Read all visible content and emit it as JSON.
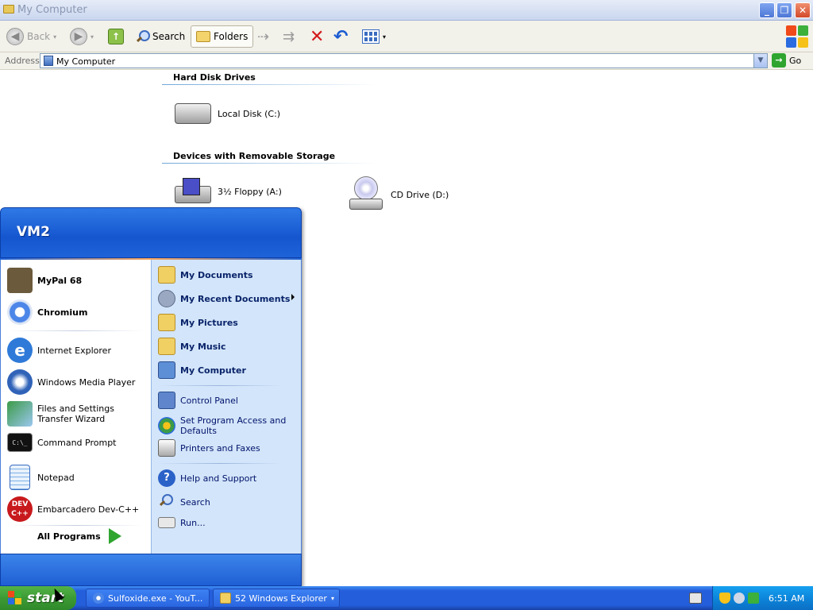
{
  "window": {
    "title": "My Computer",
    "min_glyph": "_",
    "max_glyph": "❐",
    "close_glyph": "✕"
  },
  "toolbar": {
    "back_label": "Back",
    "search_label": "Search",
    "folders_label": "Folders"
  },
  "address": {
    "label": "Address",
    "value": "My Computer",
    "go_label": "Go"
  },
  "groups": {
    "hard_disks_title": "Hard Disk Drives",
    "removable_title": "Devices with Removable Storage"
  },
  "drives": {
    "local_disk": "Local Disk (C:)",
    "floppy": "3½ Floppy (A:)",
    "cd": "CD Drive (D:)"
  },
  "start_menu": {
    "user": "VM2",
    "pinned": [
      {
        "label": "MyPal 68",
        "icon": "mypal-icon",
        "color": "#6b5a3c"
      },
      {
        "label": "Chromium",
        "icon": "chromium-icon",
        "color": "#4b86e8"
      }
    ],
    "recent": [
      {
        "label": "Internet Explorer",
        "icon": "internet-explorer-icon",
        "color": "#2f7ad8"
      },
      {
        "label": "Windows Media Player",
        "icon": "media-player-icon",
        "color": "#3063b8"
      },
      {
        "label": "Files and Settings Transfer Wizard",
        "icon": "transfer-wizard-icon",
        "color": "#3c9b47"
      },
      {
        "label": "Command Prompt",
        "icon": "command-prompt-icon",
        "color": "#111111"
      },
      {
        "label": "Notepad",
        "icon": "notepad-icon",
        "color": "#7fb2e8"
      },
      {
        "label": "Embarcadero Dev-C++",
        "icon": "devcpp-icon",
        "color": "#c8191c"
      }
    ],
    "all_programs": "All Programs",
    "right_bold": [
      {
        "label": "My Documents",
        "icon": "my-documents-icon",
        "color": "#f0cf63"
      },
      {
        "label": "My Recent Documents",
        "icon": "recent-documents-icon",
        "color": "#9aa8c2"
      },
      {
        "label": "My Pictures",
        "icon": "my-pictures-icon",
        "color": "#f0cf63"
      },
      {
        "label": "My Music",
        "icon": "my-music-icon",
        "color": "#f0cf63"
      },
      {
        "label": "My Computer",
        "icon": "my-computer-icon",
        "color": "#5d8fd6"
      }
    ],
    "right_settings": [
      {
        "label": "Control Panel",
        "icon": "control-panel-icon",
        "color": "#5f86cc"
      },
      {
        "label": "Set Program Access and Defaults",
        "icon": "program-access-icon",
        "color": "#3c9b47"
      },
      {
        "label": "Printers and Faxes",
        "icon": "printer-icon",
        "color": "#a9a9a9"
      }
    ],
    "right_help": [
      {
        "label": "Help and Support",
        "icon": "help-icon",
        "color": "#2b62c8"
      },
      {
        "label": "Search",
        "icon": "search-icon",
        "color": "#cfe0fb"
      },
      {
        "label": "Run...",
        "icon": "run-icon",
        "color": "#e8e8e8"
      }
    ]
  },
  "taskbar": {
    "start_label": "start",
    "tasks": [
      {
        "label": "Sulfoxide.exe - YouT..."
      },
      {
        "label": "52 Windows Explorer"
      }
    ],
    "clock": "6:51 AM"
  }
}
